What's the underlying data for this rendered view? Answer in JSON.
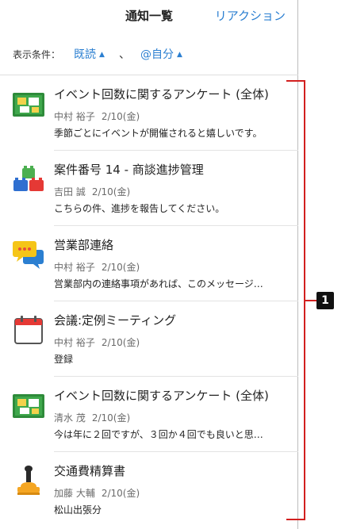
{
  "header": {
    "title": "通知一覧",
    "reaction_label": "リアクション"
  },
  "filter": {
    "label": "表示条件：",
    "read_status": "既読",
    "separator": "、",
    "target": "@自分"
  },
  "notifications": [
    {
      "icon": "bulletin-board-icon",
      "title": "イベント回数に関するアンケート (全体)",
      "author": "中村 裕子",
      "date": "2/10(金)",
      "message": "季節ごとにイベントが開催されると嬉しいです。"
    },
    {
      "icon": "blocks-icon",
      "title": "案件番号 14 - 商談進捗管理",
      "author": "吉田 誠",
      "date": "2/10(金)",
      "message": "こちらの件、進捗を報告してください。"
    },
    {
      "icon": "chat-bubbles-icon",
      "title": "営業部連絡",
      "author": "中村 裕子",
      "date": "2/10(金)",
      "message": "営業部内の連絡事項があれば、このメッセージ…"
    },
    {
      "icon": "calendar-icon",
      "title": "会議:定例ミーティング",
      "author": "中村 裕子",
      "date": "2/10(金)",
      "message": "登録"
    },
    {
      "icon": "bulletin-board-icon",
      "title": "イベント回数に関するアンケート (全体)",
      "author": "清水 茂",
      "date": "2/10(金)",
      "message": "今は年に２回ですが、３回か４回でも良いと思…"
    },
    {
      "icon": "stamp-icon",
      "title": "交通費精算書",
      "author": "加藤 大輔",
      "date": "2/10(金)",
      "message": "松山出張分"
    }
  ],
  "annotation": {
    "badge": "1",
    "color": "#d2201f"
  },
  "colors": {
    "accent": "#2b7fd1",
    "meta": "#6b6b6b"
  }
}
